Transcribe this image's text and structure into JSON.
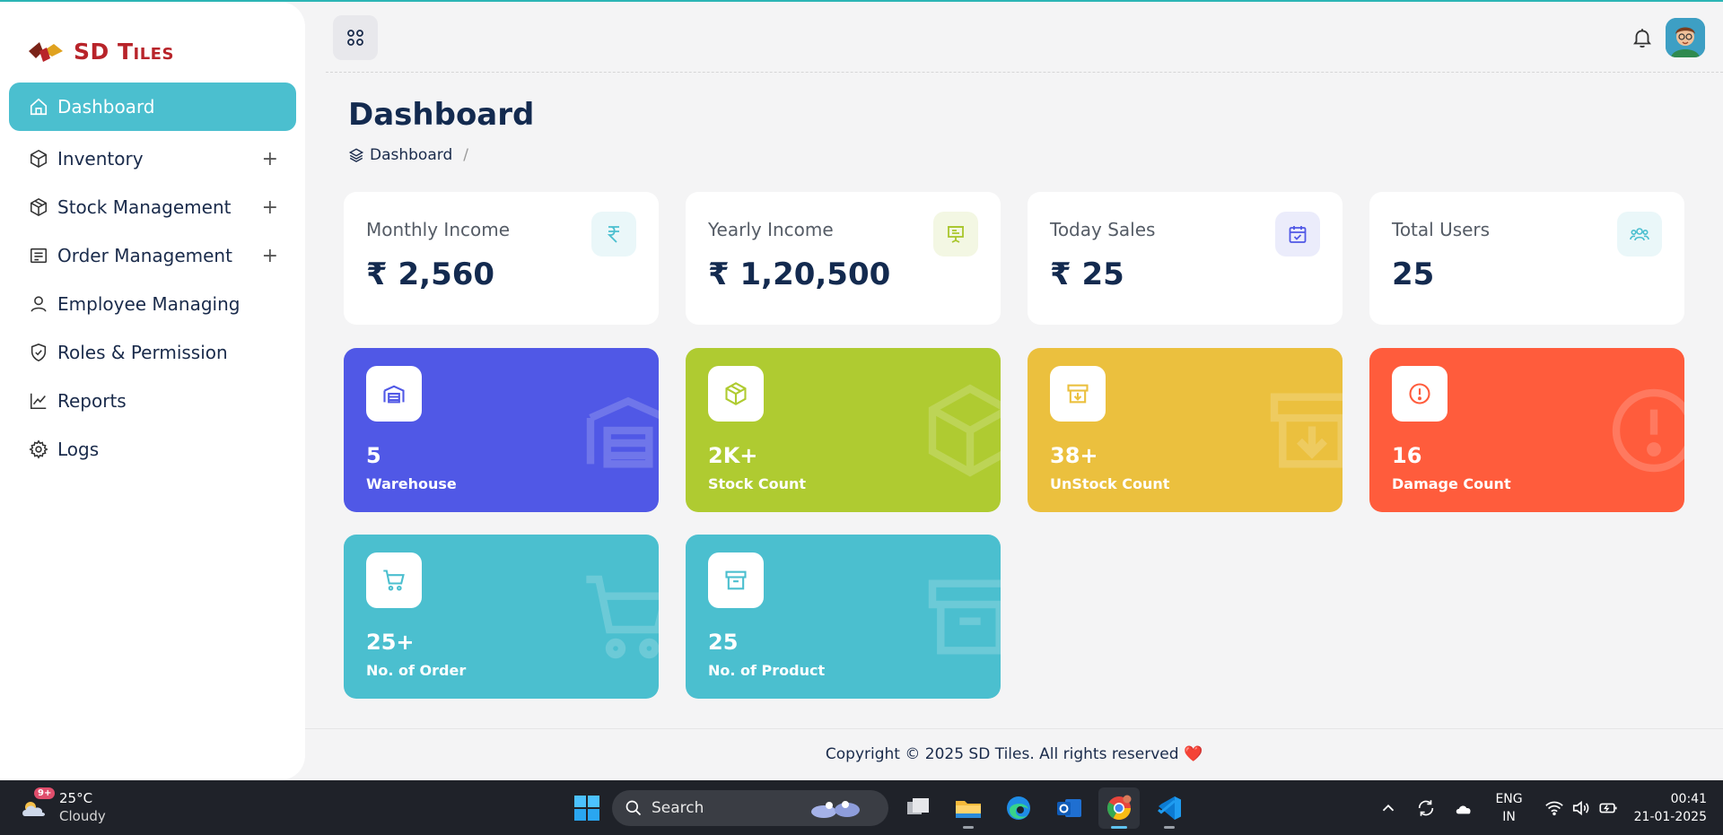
{
  "brand": {
    "name": "SD Tiles",
    "logo_icon": "sd-tiles-logo"
  },
  "sidebar": {
    "items": [
      {
        "label": "Dashboard",
        "icon": "home-icon",
        "active": true,
        "expandable": false
      },
      {
        "label": "Inventory",
        "icon": "cube-icon",
        "active": false,
        "expandable": true,
        "toggle": "+"
      },
      {
        "label": "Stock Management",
        "icon": "box-icon",
        "active": false,
        "expandable": true,
        "toggle": "+"
      },
      {
        "label": "Order Management",
        "icon": "receipt-icon",
        "active": false,
        "expandable": true,
        "toggle": "+"
      },
      {
        "label": "Employee Managing",
        "icon": "user-icon",
        "active": false,
        "expandable": false
      },
      {
        "label": "Roles & Permission",
        "icon": "shield-check-icon",
        "active": false,
        "expandable": false
      },
      {
        "label": "Reports",
        "icon": "chart-line-icon",
        "active": false,
        "expandable": false
      },
      {
        "label": "Logs",
        "icon": "gear-icon",
        "active": false,
        "expandable": false
      }
    ]
  },
  "header": {
    "menu_icon": "grid-icon",
    "notification_icon": "bell-icon",
    "avatar": "user-avatar"
  },
  "page": {
    "title": "Dashboard",
    "breadcrumb": {
      "current": "Dashboard",
      "separator": "/"
    }
  },
  "stats": [
    {
      "label": "Monthly Income",
      "value": "₹ 2,560",
      "icon": "rupee-icon",
      "icon_color": "#4bbfcf",
      "icon_bg": "#eaf7f9"
    },
    {
      "label": "Yearly Income",
      "value": "₹ 1,20,500",
      "icon": "presentation-icon",
      "icon_color": "#a9c62c",
      "icon_bg": "#f3f7e3"
    },
    {
      "label": "Today Sales",
      "value": "₹ 25",
      "icon": "calendar-check-icon",
      "icon_color": "#5058e6",
      "icon_bg": "#ebecfb"
    },
    {
      "label": "Total Users",
      "value": "25",
      "icon": "users-icon",
      "icon_color": "#4bbfcf",
      "icon_bg": "#eaf7f9"
    }
  ],
  "tiles": [
    {
      "value": "5",
      "label": "Warehouse",
      "icon": "warehouse-icon",
      "color": "#5058e6"
    },
    {
      "value": "2K+",
      "label": "Stock Count",
      "icon": "cube-icon",
      "color": "#afcb31"
    },
    {
      "value": "38+",
      "label": "UnStock Count",
      "icon": "archive-down-icon",
      "color": "#ebc03e"
    },
    {
      "value": "16",
      "label": "Damage Count",
      "icon": "alert-circle-icon",
      "color": "#ff5c3c"
    },
    {
      "value": "25+",
      "label": "No. of Order",
      "icon": "cart-icon",
      "color": "#4bbfcf"
    },
    {
      "value": "25",
      "label": "No. of Product",
      "icon": "archive-box-icon",
      "color": "#4bbfcf"
    }
  ],
  "footer": {
    "text": "Copyright © 2025 SD Tiles. All rights reserved",
    "heart": "❤️"
  },
  "taskbar": {
    "weather": {
      "temp": "25°C",
      "condition": "Cloudy",
      "badge": "9+"
    },
    "search_placeholder": "Search",
    "apps": [
      "windows-start-icon",
      "task-view-icon",
      "file-explorer-icon",
      "edge-icon",
      "outlook-icon",
      "chrome-icon",
      "vscode-icon"
    ],
    "language": {
      "line1": "ENG",
      "line2": "IN"
    },
    "clock": {
      "time": "00:41",
      "date": "21-01-2025"
    }
  }
}
